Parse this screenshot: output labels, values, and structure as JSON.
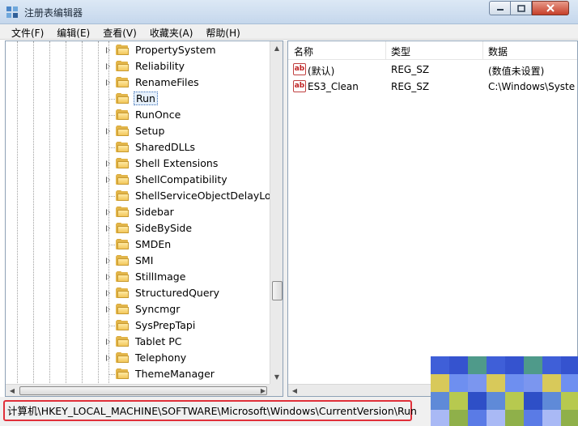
{
  "window": {
    "title": "注册表编辑器"
  },
  "menu": [
    {
      "label": "文件(F)"
    },
    {
      "label": "编辑(E)"
    },
    {
      "label": "查看(V)"
    },
    {
      "label": "收藏夹(A)"
    },
    {
      "label": "帮助(H)"
    }
  ],
  "tree": {
    "items": [
      {
        "label": "PropertySystem",
        "expandable": true
      },
      {
        "label": "Reliability",
        "expandable": true
      },
      {
        "label": "RenameFiles",
        "expandable": true
      },
      {
        "label": "Run",
        "expandable": false,
        "selected": true
      },
      {
        "label": "RunOnce",
        "expandable": false
      },
      {
        "label": "Setup",
        "expandable": true
      },
      {
        "label": "SharedDLLs",
        "expandable": false
      },
      {
        "label": "Shell Extensions",
        "expandable": true
      },
      {
        "label": "ShellCompatibility",
        "expandable": true
      },
      {
        "label": "ShellServiceObjectDelayLoad",
        "expandable": false
      },
      {
        "label": "Sidebar",
        "expandable": true
      },
      {
        "label": "SideBySide",
        "expandable": true
      },
      {
        "label": "SMDEn",
        "expandable": false
      },
      {
        "label": "SMI",
        "expandable": true
      },
      {
        "label": "StillImage",
        "expandable": true
      },
      {
        "label": "StructuredQuery",
        "expandable": true
      },
      {
        "label": "Syncmgr",
        "expandable": true
      },
      {
        "label": "SysPrepTapi",
        "expandable": false
      },
      {
        "label": "Tablet PC",
        "expandable": true
      },
      {
        "label": "Telephony",
        "expandable": true
      },
      {
        "label": "ThemeManager",
        "expandable": false
      }
    ]
  },
  "list": {
    "columns": [
      {
        "label": "名称"
      },
      {
        "label": "类型"
      },
      {
        "label": "数据"
      }
    ],
    "rows": [
      {
        "name": "(默认)",
        "type": "REG_SZ",
        "data": "(数值未设置)",
        "icon": "string-value-icon"
      },
      {
        "name": "ES3_Clean",
        "type": "REG_SZ",
        "data": "C:\\Windows\\Syste",
        "icon": "string-value-icon"
      }
    ]
  },
  "status": {
    "path": "计算机\\HKEY_LOCAL_MACHINE\\SOFTWARE\\Microsoft\\Windows\\CurrentVersion\\Run"
  },
  "colors": {
    "highlight_box": "#e0303a",
    "folder": "#f2c75a",
    "close_button": "#c6402a"
  }
}
